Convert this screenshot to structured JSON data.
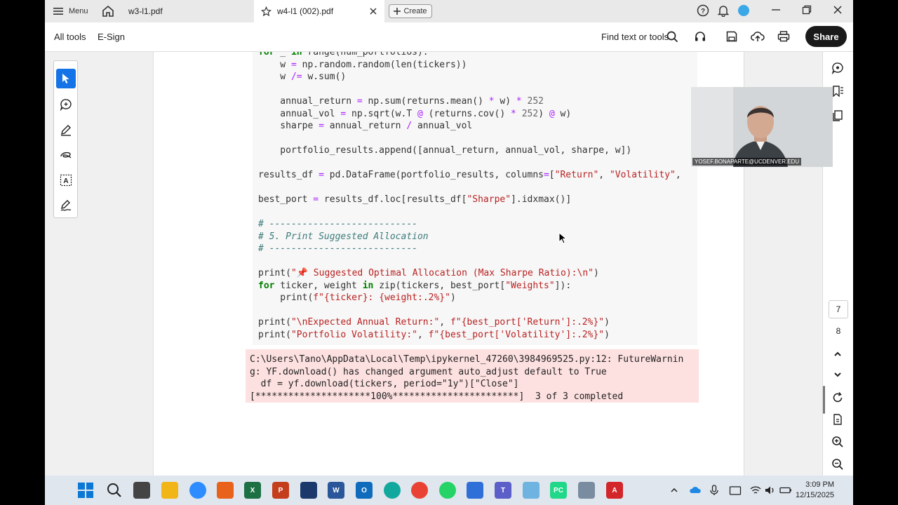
{
  "tabbar": {
    "menu_label": "Menu",
    "tabs": [
      {
        "label": "w3-l1.pdf",
        "active": false
      },
      {
        "label": "w4-l1 (002).pdf",
        "active": true
      }
    ],
    "create_label": "Create"
  },
  "toolbar": {
    "all_tools": "All tools",
    "esign": "E-Sign",
    "find_label": "Find text or tools",
    "share_label": "Share"
  },
  "code_lines": [
    {
      "segs": [
        {
          "t": "for",
          "c": "kw"
        },
        {
          "t": " _ "
        },
        {
          "t": "in",
          "c": "kw"
        },
        {
          "t": " range(num_portfolios):"
        }
      ]
    },
    {
      "segs": [
        {
          "t": "    w "
        },
        {
          "t": "=",
          "c": "op"
        },
        {
          "t": " np.random.random(len(tickers))"
        }
      ]
    },
    {
      "segs": [
        {
          "t": "    w "
        },
        {
          "t": "/=",
          "c": "op"
        },
        {
          "t": " w.sum()"
        }
      ]
    },
    {
      "segs": [
        {
          "t": ""
        }
      ]
    },
    {
      "segs": [
        {
          "t": "    annual_return "
        },
        {
          "t": "=",
          "c": "op"
        },
        {
          "t": " np.sum(returns.mean() "
        },
        {
          "t": "*",
          "c": "op"
        },
        {
          "t": " w) "
        },
        {
          "t": "*",
          "c": "op"
        },
        {
          "t": " "
        },
        {
          "t": "252",
          "c": "num"
        }
      ]
    },
    {
      "segs": [
        {
          "t": "    annual_vol "
        },
        {
          "t": "=",
          "c": "op"
        },
        {
          "t": " np.sqrt(w.T "
        },
        {
          "t": "@",
          "c": "op"
        },
        {
          "t": " (returns.cov() "
        },
        {
          "t": "*",
          "c": "op"
        },
        {
          "t": " "
        },
        {
          "t": "252",
          "c": "num"
        },
        {
          "t": ") "
        },
        {
          "t": "@",
          "c": "op"
        },
        {
          "t": " w)"
        }
      ]
    },
    {
      "segs": [
        {
          "t": "    sharpe "
        },
        {
          "t": "=",
          "c": "op"
        },
        {
          "t": " annual_return "
        },
        {
          "t": "/",
          "c": "op"
        },
        {
          "t": " annual_vol"
        }
      ]
    },
    {
      "segs": [
        {
          "t": ""
        }
      ]
    },
    {
      "segs": [
        {
          "t": "    portfolio_results.append([annual_return, annual_vol, sharpe, w])"
        }
      ]
    },
    {
      "segs": [
        {
          "t": ""
        }
      ]
    },
    {
      "segs": [
        {
          "t": "results_df "
        },
        {
          "t": "=",
          "c": "op"
        },
        {
          "t": " pd.DataFrame(portfolio_results, columns"
        },
        {
          "t": "=",
          "c": "op"
        },
        {
          "t": "["
        },
        {
          "t": "\"Return\"",
          "c": "str"
        },
        {
          "t": ", "
        },
        {
          "t": "\"Volatility\"",
          "c": "str"
        },
        {
          "t": ","
        }
      ]
    },
    {
      "segs": [
        {
          "t": ""
        }
      ]
    },
    {
      "segs": [
        {
          "t": "best_port "
        },
        {
          "t": "=",
          "c": "op"
        },
        {
          "t": " results_df.loc[results_df["
        },
        {
          "t": "\"Sharpe\"",
          "c": "str"
        },
        {
          "t": "].idxmax()]"
        }
      ]
    },
    {
      "segs": [
        {
          "t": ""
        }
      ]
    },
    {
      "segs": [
        {
          "t": "# ---------------------------",
          "c": "cmt"
        }
      ]
    },
    {
      "segs": [
        {
          "t": "# 5. Print Suggested Allocation",
          "c": "cmt"
        }
      ]
    },
    {
      "segs": [
        {
          "t": "# ---------------------------",
          "c": "cmt"
        }
      ]
    },
    {
      "segs": [
        {
          "t": ""
        }
      ]
    },
    {
      "segs": [
        {
          "t": "print("
        },
        {
          "t": "\"📌 Suggested Optimal Allocation (Max Sharpe Ratio):\\n\"",
          "c": "str"
        },
        {
          "t": ")"
        }
      ]
    },
    {
      "segs": [
        {
          "t": "for",
          "c": "kw"
        },
        {
          "t": " ticker, weight "
        },
        {
          "t": "in",
          "c": "kw"
        },
        {
          "t": " zip(tickers, best_port["
        },
        {
          "t": "\"Weights\"",
          "c": "str"
        },
        {
          "t": "]):"
        }
      ]
    },
    {
      "segs": [
        {
          "t": "    print("
        },
        {
          "t": "f\"{ticker}: {weight:.2%}\"",
          "c": "str"
        },
        {
          "t": ")"
        }
      ]
    },
    {
      "segs": [
        {
          "t": ""
        }
      ]
    },
    {
      "segs": [
        {
          "t": "print("
        },
        {
          "t": "\"\\nExpected Annual Return:\"",
          "c": "str"
        },
        {
          "t": ", "
        },
        {
          "t": "f\"{best_port['Return']:.2%}\"",
          "c": "str"
        },
        {
          "t": ")"
        }
      ]
    },
    {
      "segs": [
        {
          "t": "print("
        },
        {
          "t": "\"Portfolio Volatility:\"",
          "c": "str"
        },
        {
          "t": ", "
        },
        {
          "t": "f\"{best_port['Volatility']:.2%}\"",
          "c": "str"
        },
        {
          "t": ")"
        }
      ]
    }
  ],
  "output_lines": [
    "C:\\Users\\Tano\\AppData\\Local\\Temp\\ipykernel_47260\\3984969525.py:12: FutureWarnin",
    "g: YF.download() has changed argument auto_adjust default to True",
    "  df = yf.download(tickers, period=\"1y\")[\"Close\"]",
    "[*********************100%***********************]  3 of 3 completed"
  ],
  "sidebar": {
    "page_current": "7",
    "page_next": "8"
  },
  "webcam": {
    "label": "YOSEF.BONAPARTE@UCDENVER.EDU"
  },
  "taskbar": {
    "time": "3:09 PM",
    "date": "12/15/2025"
  },
  "colors": {
    "accent": "#1473e6",
    "error_bg": "#fde0e0",
    "code_bg": "#f7f7f7"
  }
}
